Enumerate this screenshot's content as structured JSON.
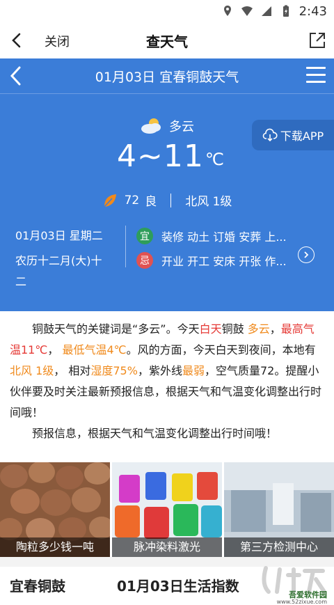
{
  "status_bar": {
    "time": "2:43"
  },
  "app_bar": {
    "close_label": "关闭",
    "title": "查天气"
  },
  "weather_nav": {
    "title": "01月03日 宜春铜鼓天气"
  },
  "current": {
    "condition": "多云",
    "temp_range": "4~11",
    "temp_unit": "℃",
    "aqi_value": "72",
    "aqi_level": "良",
    "wind": "北风 1级",
    "download_label": "下载APP"
  },
  "almanac": {
    "date": "01月03日 星期二",
    "lunar": "农历十二月(大)十二",
    "yi_badge": "宜",
    "yi_text": "装修 动土 订婚 安葬 上...",
    "ji_badge": "忌",
    "ji_text": "开业 开工 安床 开张 作..."
  },
  "article": {
    "p1_a": "铜鼓天气的关键词是“多云”。今天",
    "p1_b": "白天",
    "p1_c": "铜鼓 ",
    "p1_d": "多云",
    "p1_e": "，",
    "p1_f": "最高气温11℃",
    "p1_g": "， ",
    "p1_h": "最低气温4℃",
    "p1_i": "。风的方面，今天白天到夜间，本地有",
    "p1_j": "北风 1级",
    "p1_k": "， 相对",
    "p1_l": "湿度75%",
    "p1_m": "，紫外线",
    "p1_n": "最弱",
    "p1_o": "，空气质量72。提醒小伙伴要及时关注最新预报信息，根据天气和气温变化调整出行时间哦！",
    "p2": "预报信息，根据天气和气温变化调整出行时间哦！"
  },
  "gallery": [
    {
      "caption": "陶粒多少钱一吨"
    },
    {
      "caption": "脉冲染料激光"
    },
    {
      "caption": "第三方检测中心"
    }
  ],
  "lower": {
    "title_left": "宜春铜鼓",
    "title_right": "01月03日生活指数"
  },
  "watermark": {
    "text": "吾爱软件园",
    "url": "www.52zixue.com"
  },
  "colors": {
    "hero_bg": "#3b7dd8",
    "highlight_orange": "#f08a1c",
    "highlight_red": "#e53935",
    "yi_green": "#2e9d5b",
    "ji_red": "#e05252"
  }
}
